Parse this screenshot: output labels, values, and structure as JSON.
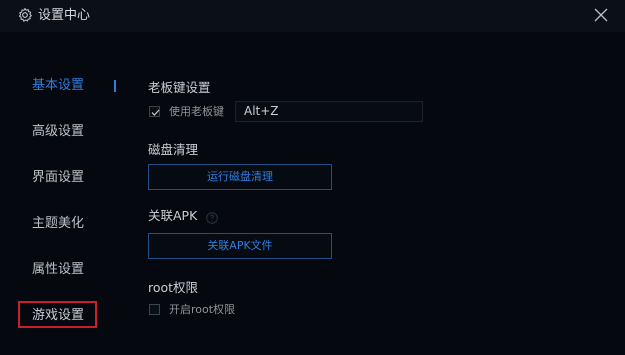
{
  "window": {
    "title": "设置中心",
    "icons": {
      "title": "gear-icon",
      "close": "close-icon"
    }
  },
  "sidebar": {
    "items": [
      {
        "label": "基本设置",
        "active": true
      },
      {
        "label": "高级设置",
        "active": false
      },
      {
        "label": "界面设置",
        "active": false
      },
      {
        "label": "主题美化",
        "active": false
      },
      {
        "label": "属性设置",
        "active": false
      },
      {
        "label": "游戏设置",
        "active": false,
        "highlighted": true
      }
    ]
  },
  "boss_key": {
    "title": "老板键设置",
    "checkbox_label": "使用老板键",
    "checked": true,
    "hotkey_value": "Alt+Z"
  },
  "disk_cleanup": {
    "title": "磁盘清理",
    "button_label": "运行磁盘清理"
  },
  "apk_association": {
    "title": "关联APK",
    "help_icon": "question-circle-icon",
    "button_label": "关联APK文件"
  },
  "root": {
    "title": "root权限",
    "checkbox_label": "开启root权限",
    "checked": false
  },
  "colors": {
    "background": "#05090f",
    "titlebar": "#0b1016",
    "accent": "#2f7de0",
    "highlight": "#c8202a",
    "text": "#c9ced6"
  }
}
